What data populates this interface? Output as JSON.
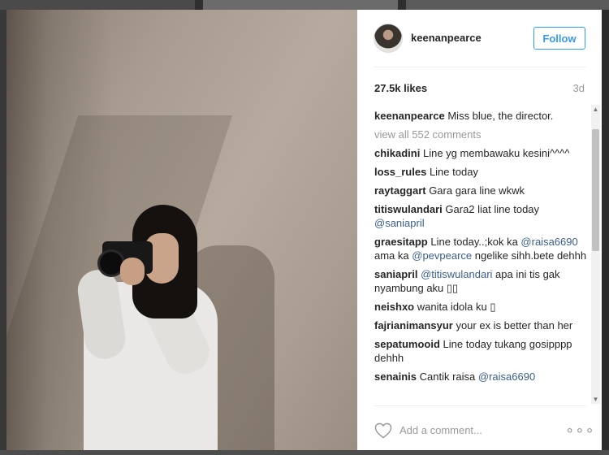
{
  "post": {
    "username": "keenanpearce",
    "follow_label": "Follow",
    "likes": "27.5k likes",
    "time": "3d",
    "view_all": "view all 552 comments",
    "add_comment_placeholder": "Add a comment...",
    "more_label": "∘∘∘",
    "caption": {
      "user": "keenanpearce",
      "text": " Miss blue, the director."
    }
  },
  "comments": [
    {
      "user": "chikadini",
      "text": " Line yg membawaku kesini^^^^"
    },
    {
      "user": "loss_rules",
      "text": " Line today"
    },
    {
      "user": "raytaggart",
      "text": " Gara gara line wkwk"
    },
    {
      "user": "titiswulandari",
      "text": " Gara2 liat line today ",
      "mention": "@saniapril"
    },
    {
      "user": "graesitapp",
      "text": " Line today..;kok ka ",
      "mention": "@raisa6690",
      "text2": " ama ka ",
      "mention2": "@pevpearce",
      "text3": " ngelike sihh.bete dehhh"
    },
    {
      "user": "saniapril",
      "text": " ",
      "mention": "@titiswulandari",
      "text2": " apa ini tis gak nyambung aku ▯▯"
    },
    {
      "user": "neishxo",
      "text": " wanita idola ku ▯"
    },
    {
      "user": "fajrianimansyur",
      "text": " your ex is better than her"
    },
    {
      "user": "sepatumooid",
      "text": " Line today tukang gosipppp dehhh"
    },
    {
      "user": "senainis",
      "text": " Cantik raisa ",
      "mention": "@raisa6690"
    }
  ],
  "colors": {
    "accent": "#3897f0",
    "mention": "#3b5f8a",
    "muted": "#999999"
  },
  "icons": [
    "heart-icon",
    "more-options-icon",
    "scroll-up-icon",
    "scroll-down-icon"
  ]
}
